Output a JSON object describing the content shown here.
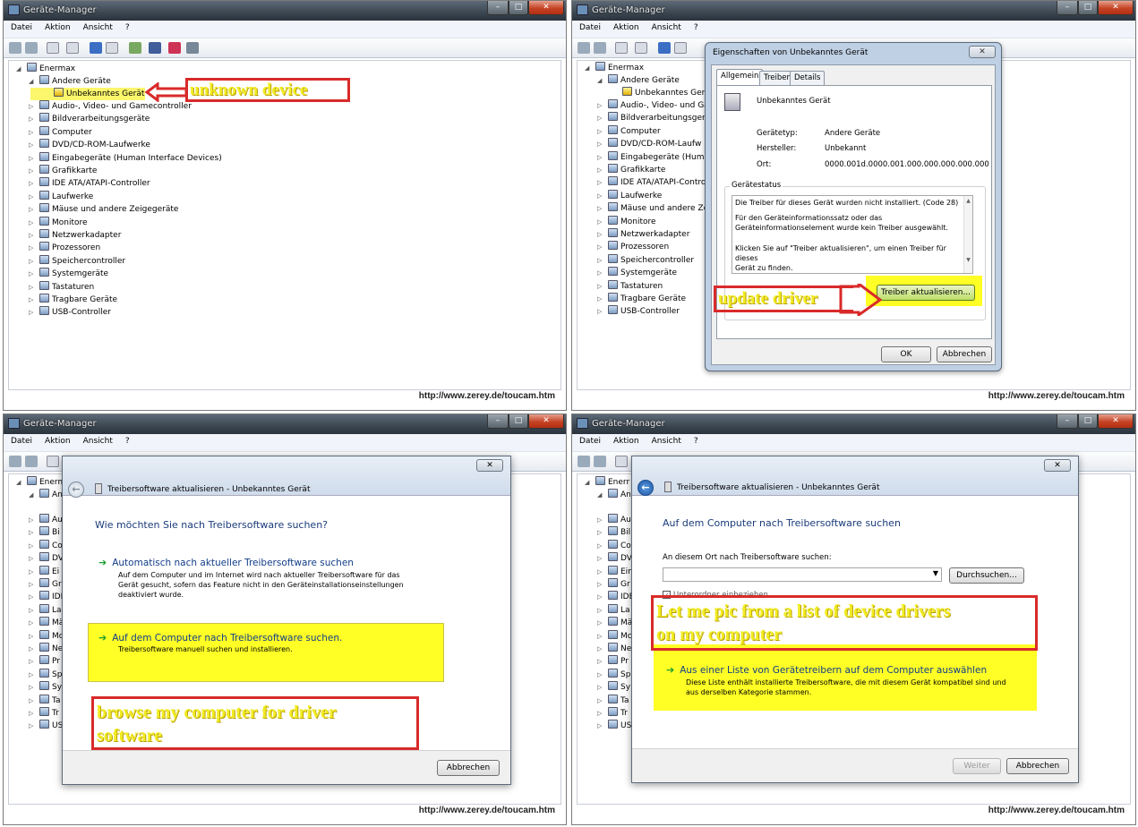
{
  "window_title": "Geräte-Manager",
  "menu": [
    "Datei",
    "Aktion",
    "Ansicht",
    "?"
  ],
  "watermark_url": "http://www.zerey.de/toucam.htm",
  "tree": {
    "root": "Enermax",
    "other": "Andere Geräte",
    "unknown": "Unbekanntes Gerät",
    "items": [
      "Audio-, Video- und Gamecontroller",
      "Bildverarbeitungsgeräte",
      "Computer",
      "DVD/CD-ROM-Laufwerke",
      "Eingabegeräte (Human Interface Devices)",
      "Grafikkarte",
      "IDE ATA/ATAPI-Controller",
      "Laufwerke",
      "Mäuse und andere Zeigegeräte",
      "Monitore",
      "Netzwerkadapter",
      "Prozessoren",
      "Speichercontroller",
      "Systemgeräte",
      "Tastaturen",
      "Tragbare Geräte",
      "USB-Controller"
    ],
    "items_q2": [
      "Audio-, Video- und Gam",
      "Bildverarbeitungsgerät",
      "Computer",
      "DVD/CD-ROM-Laufw",
      "Eingabegeräte (Hum",
      "Grafikkarte",
      "IDE ATA/ATAPI-Contro",
      "Laufwerke",
      "Mäuse und andere Ze",
      "Monitore",
      "Netzwerkadapter",
      "Prozessoren",
      "Speichercontroller",
      "Systemgeräte",
      "Tastaturen",
      "Tragbare Geräte",
      "USB-Controller"
    ],
    "root_q3": "Enerm",
    "root_q4": "Enerr",
    "other_q3": "An",
    "other_q4": "An",
    "items_q3": [
      "Au",
      "Bi",
      "Co",
      "DV",
      "Ei",
      "Gr",
      "IDE",
      "La",
      "Mä",
      "Mo",
      "Ne",
      "Pr",
      "Sp",
      "Sy",
      "Ta",
      "Tr",
      "US"
    ],
    "items_q4": [
      "Au",
      "Bil",
      "Co",
      "DV",
      "Ein",
      "Gr",
      "IDE",
      "La",
      "Mä",
      "Mc",
      "Ne",
      "Pr",
      "Sp",
      "Sy",
      "Ta",
      "Tr",
      "US"
    ]
  },
  "annotations": {
    "q1": "unknown device",
    "q2": "update driver",
    "q3": "browse my computer for driver\nsoftware",
    "q4": "Let me pic from a list of device drivers\non my computer"
  },
  "props": {
    "title": "Eigenschaften von Unbekanntes Gerät",
    "close": "✕",
    "tabs": [
      "Allgemein",
      "Treiber",
      "Details"
    ],
    "device": "Unbekanntes Gerät",
    "type_label": "Gerätetyp:",
    "type_value": "Andere Geräte",
    "maker_label": "Hersteller:",
    "maker_value": "Unbekannt",
    "loc_label": "Ort:",
    "loc_value": "0000.001d.0000.001.000.000.000.000.000",
    "status_group": "Gerätestatus",
    "status_lines": [
      "Die Treiber für dieses Gerät wurden nicht installiert. (Code 28)",
      "Für den Geräteinformationssatz oder das",
      "Geräteinformationselement wurde kein Treiber ausgewählt.",
      "Klicken Sie auf \"Treiber aktualisieren\", um einen Treiber für dieses",
      "Gerät zu finden."
    ],
    "update_button": "Treiber aktualisieren...",
    "ok": "OK",
    "cancel": "Abbrechen"
  },
  "wizard": {
    "title": "Treibersoftware aktualisieren - Unbekanntes Gerät",
    "close": "✕",
    "q3_question": "Wie möchten Sie nach Treibersoftware suchen?",
    "auto_title": "Automatisch nach aktueller Treibersoftware suchen",
    "auto_desc": [
      "Auf dem Computer und im Internet wird nach aktueller Treibersoftware für das",
      "Gerät gesucht, sofern das Feature nicht in den Geräteinstallationseinstellungen",
      "deaktiviert wurde."
    ],
    "browse_title": "Auf dem Computer nach Treibersoftware suchen.",
    "browse_desc": "Treibersoftware manuell suchen und installieren.",
    "cancel": "Abbrechen",
    "q4_heading": "Auf dem Computer nach Treibersoftware suchen",
    "location_label": "An diesem Ort nach Treibersoftware suchen:",
    "browse_button": "Durchsuchen...",
    "subfolders": "Unterordner einbeziehen",
    "list_title": "Aus einer Liste von Gerätetreibern auf dem Computer auswählen",
    "list_desc": [
      "Diese Liste enthält installierte Treibersoftware, die mit diesem Gerät kompatibel sind und",
      "aus derselben Kategorie stammen."
    ],
    "next": "Weiter"
  }
}
